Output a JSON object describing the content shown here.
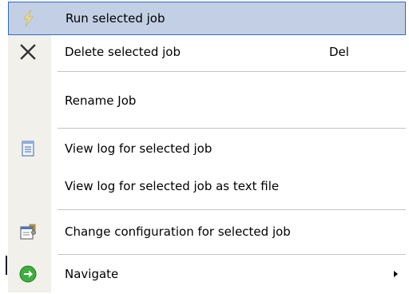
{
  "context_menu": {
    "items": [
      {
        "label": "Run selected job",
        "icon": "lightning-icon",
        "shortcut": ""
      },
      {
        "label": "Delete selected job",
        "icon": "delete-x-icon",
        "shortcut": "Del"
      },
      {
        "label": "Rename Job",
        "icon": "",
        "shortcut": ""
      },
      {
        "label": "View log for selected job",
        "icon": "log-document-icon",
        "shortcut": ""
      },
      {
        "label": "View log for selected job as text file",
        "icon": "",
        "shortcut": ""
      },
      {
        "label": "Change configuration for selected job",
        "icon": "configuration-icon",
        "shortcut": ""
      },
      {
        "label": "Navigate",
        "icon": "green-arrow-icon",
        "shortcut": "",
        "submenu": true
      }
    ],
    "highlighted_item": "Run selected job"
  },
  "colors": {
    "highlight_fill": "#c2cfe5",
    "highlight_border": "#316ac5",
    "gutter": "#f1f0ea",
    "separator": "#c5c5c5"
  }
}
